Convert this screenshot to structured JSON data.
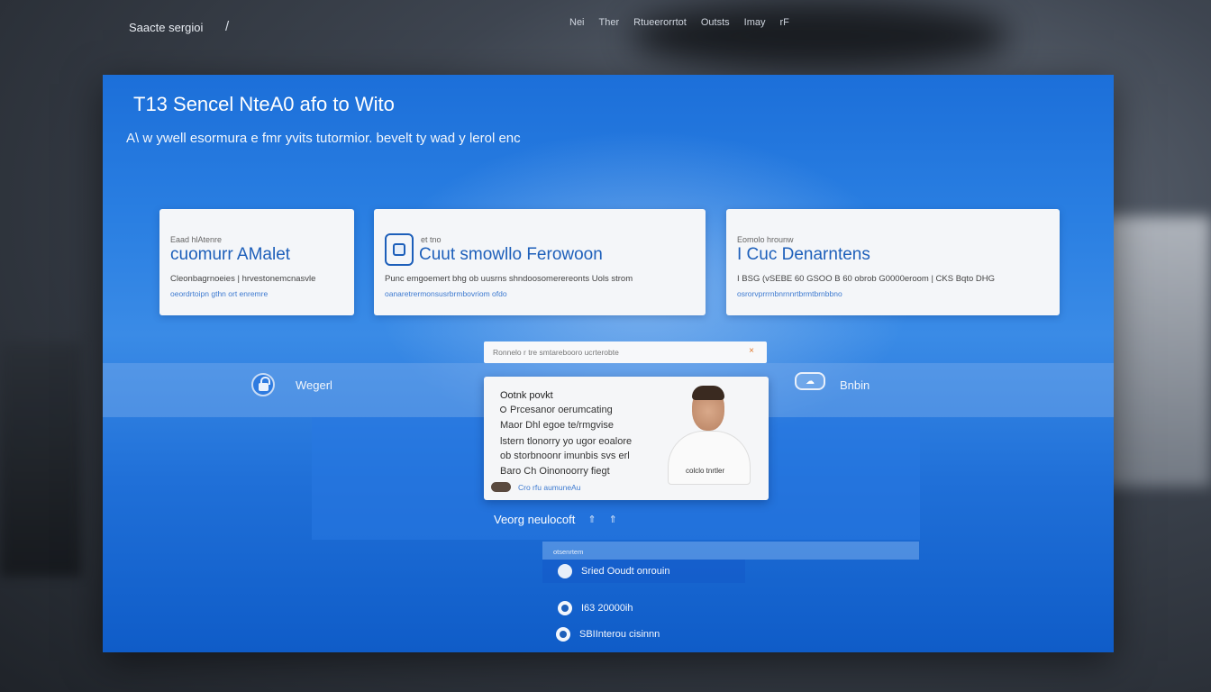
{
  "topbar": {
    "brand": "Saacte sergioi",
    "edit_glyph": "/",
    "nav": [
      "Nei",
      "Ther",
      "Rtueerorrtot",
      "Outsts",
      "Imay",
      "rF"
    ]
  },
  "panel": {
    "title": "T13 Sencel NteA0 afo to Wito",
    "subtitle": "A\\ w ywell esormura e fmr yvits tutormior. bevelt ty wad y lerol enc"
  },
  "cards": [
    {
      "kicker": "Eaad hlAtenre",
      "title": "cuomurr AMalet",
      "line1": "Cleonbagrnoeies  |  hrvestonemcnasvle",
      "line2": "oeordrtoipn gthn ort enremre"
    },
    {
      "kicker": "et tno",
      "title": "Cuut smowllo Ferowoon",
      "line1": "Punc emgoemert bhg ob uusrns shndoosomerereonts Uols strom",
      "line2": "oanaretrermonsusrbrmbovriom ofdo"
    },
    {
      "kicker": "Eomolo hrounw",
      "title": "I Cuc Denarntens",
      "line1": "I  BSG (vSEBE 60 GSOO B 60 obrob G0000eroom | CKS Bqto  DHG",
      "line2": "osrorvprrrnbnrnnrtbrmtbrnbbno"
    }
  ],
  "search": {
    "placeholder": "Ronnelo r tre smtarebooro ucrterobte",
    "clear_glyph": "×"
  },
  "band": {
    "left_label": "Wegerl",
    "right_label": "Bnbin"
  },
  "profile": {
    "heading": "Ootnk povkt",
    "lines": [
      "Prcesanor oerumcating",
      "Maor Dhl egoe te/rmgvise",
      "lstern tlonorry yo ugor eoalore",
      "ob storbnoonr imunbis svs erl",
      "Baro Ch Oinonoorry fiegt"
    ],
    "footer": "Cro rfu aumuneAu",
    "caption": "colclo tnrtler"
  },
  "cta": {
    "label": "Veorg neulocoft",
    "arrow1": "⇑",
    "arrow2": "⇑"
  },
  "list": {
    "header": "otsenrtem",
    "items": [
      "Sried Ooudt onrouin",
      "I63 20000ih",
      "SBIInterou cisinnn"
    ]
  },
  "colors": {
    "panel_blue": "#2a7fe2",
    "accent_blue": "#1d5fba",
    "clear_orange": "#e0782a"
  }
}
